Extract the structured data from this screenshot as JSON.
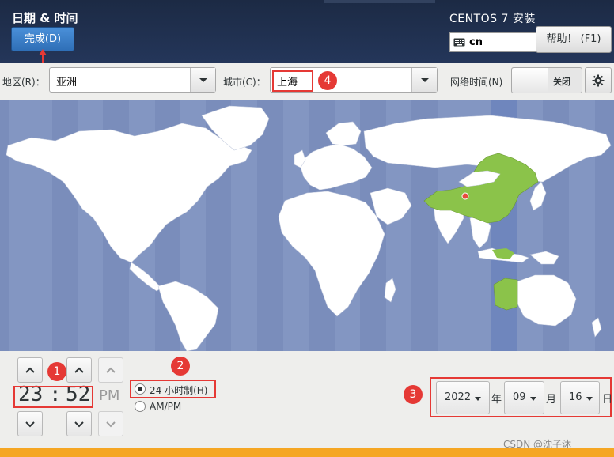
{
  "header": {
    "title": "日期 & 时间",
    "done_button": "完成(D)",
    "install_title": "CENTOS 7 安装",
    "keyboard_layout": "cn",
    "help_button": "帮助！ (F1)"
  },
  "region": {
    "label": "地区(R)：",
    "value": "亚洲"
  },
  "city": {
    "label": "城市(C)：",
    "value": "上海"
  },
  "network_time": {
    "label": "网络时间(N)",
    "toggle_label": "关闭",
    "enabled": false
  },
  "time": {
    "hours": "23",
    "separator": ":",
    "minutes": "52",
    "ampm": "PM"
  },
  "format": {
    "h24_label": "24 小时制(H)",
    "ampm_label": "AM/PM",
    "selected": "24"
  },
  "date": {
    "year": "2022",
    "year_unit": "年",
    "month": "09",
    "month_unit": "月",
    "day": "16",
    "day_unit": "日"
  },
  "annotations": {
    "badge1": "1",
    "badge2": "2",
    "badge3": "3",
    "badge4": "4"
  },
  "watermark": "CSDN @沈子沐",
  "colors": {
    "header_bg": "#1c2a44",
    "map_ocean": "#8396c2",
    "timezone_highlight": "#6f86bd",
    "selected_country": "#8bc34a",
    "annotation_red": "#e53935",
    "done_button": "#3a7fcb"
  }
}
